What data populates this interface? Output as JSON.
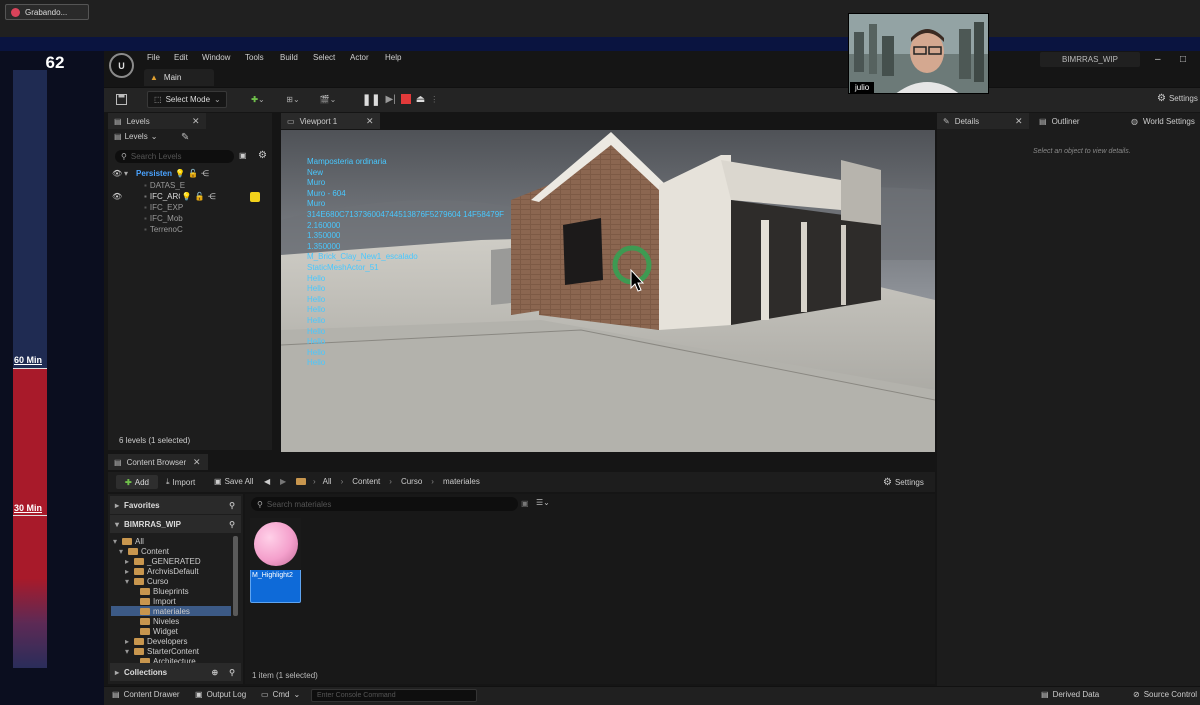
{
  "recorder": {
    "label": "Grabando..."
  },
  "timer": {
    "count": "62",
    "mark_60": "60 Min",
    "mark_30": "30 Min",
    "elapsed_fraction": 0.5
  },
  "menu": [
    "File",
    "Edit",
    "Window",
    "Tools",
    "Build",
    "Select",
    "Actor",
    "Help"
  ],
  "project_name": "BIMRRAS_WIP",
  "main_tab": "Main",
  "toolbar": {
    "select_mode": "Select Mode",
    "settings": "Settings"
  },
  "levels": {
    "tab": "Levels",
    "dropdown": "Levels",
    "search_placeholder": "Search Levels",
    "rows": [
      {
        "name": "Persistent",
        "kind": "persistent"
      },
      {
        "name": "DATAS_E",
        "kind": "sub"
      },
      {
        "name": "IFC_ARQ",
        "kind": "main"
      },
      {
        "name": "IFC_EXP",
        "kind": "sub"
      },
      {
        "name": "IFC_Mob",
        "kind": "sub"
      },
      {
        "name": "TerrenoC",
        "kind": "sub"
      }
    ],
    "status": "6 levels (1 selected)",
    "highlight_color": "#f2d21b"
  },
  "viewport": {
    "tab": "Viewport 1",
    "debug_lines": [
      "Mamposteria ordinaria",
      "New",
      "Muro",
      "Muro - 604",
      "Muro",
      "314E680C713736004744513876F5279604 14F58479F",
      "2.160000",
      "1.350000",
      "1.350000",
      "M_Brick_Clay_New1_escalado",
      "StaticMeshActor_51",
      "Hello",
      "Hello",
      "Hello",
      "Hello",
      "Hello",
      "Hello",
      "Hello",
      "Hello",
      "Hello"
    ],
    "debug_color": "#48c8ff"
  },
  "details": {
    "tab": "Details",
    "outliner_tab": "Outliner",
    "world_settings_tab": "World Settings",
    "hint": "Select an object to view details."
  },
  "content_browser": {
    "tab": "Content Browser",
    "add": "Add",
    "import": "Import",
    "save_all": "Save All",
    "path": [
      "All",
      "Content",
      "Curso",
      "materiales"
    ],
    "settings": "Settings",
    "favorites": "Favorites",
    "project_root": "BIMRRAS_WIP",
    "tree": [
      {
        "label": "All",
        "depth": 0,
        "expanded": true
      },
      {
        "label": "Content",
        "depth": 1,
        "expanded": true
      },
      {
        "label": "_GENERATED",
        "depth": 2
      },
      {
        "label": "ArchvisDefault",
        "depth": 2
      },
      {
        "label": "Curso",
        "depth": 2,
        "expanded": true
      },
      {
        "label": "Blueprints",
        "depth": 3
      },
      {
        "label": "Import",
        "depth": 3
      },
      {
        "label": "materiales",
        "depth": 3,
        "selected": true
      },
      {
        "label": "Niveles",
        "depth": 3
      },
      {
        "label": "Widget",
        "depth": 3
      },
      {
        "label": "Developers",
        "depth": 2
      },
      {
        "label": "StarterContent",
        "depth": 2,
        "expanded": true
      },
      {
        "label": "Architecture",
        "depth": 3
      }
    ],
    "collections": "Collections",
    "search_placeholder": "Search materiales",
    "assets": [
      {
        "name": "M_Highlight2"
      }
    ],
    "status": "1 item (1 selected)"
  },
  "statusbar": {
    "content_drawer": "Content Drawer",
    "output_log": "Output Log",
    "cmd": "Cmd",
    "console_placeholder": "Enter Console Command",
    "derived_data": "Derived Data",
    "source_control": "Source Control"
  },
  "webcam": {
    "name": "julio"
  }
}
